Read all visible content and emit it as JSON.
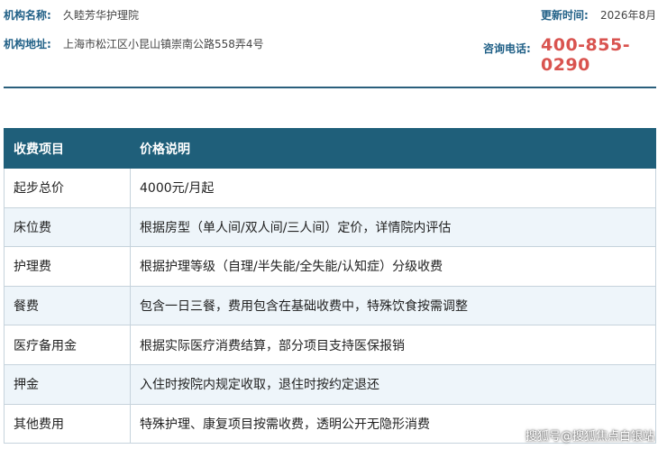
{
  "header": {
    "org_name_label": "机构名称:",
    "org_name": "久睦芳华护理院",
    "org_addr_label": "机构地址:",
    "org_addr": "上海市松江区小昆山镇崇南公路558弄4号",
    "updated_label": "更新时间:",
    "updated": "2026年8月",
    "phone_label": "咨询电话:",
    "phone": "400-855-0290"
  },
  "table": {
    "headers": [
      "收费项目",
      "价格说明"
    ],
    "rows": [
      [
        "起步总价",
        "4000元/月起"
      ],
      [
        "床位费",
        "根据房型（单人间/双人间/三人间）定价，详情院内评估"
      ],
      [
        "护理费",
        "根据护理等级（自理/半失能/全失能/认知症）分级收费"
      ],
      [
        "餐费",
        "包含一日三餐，费用包含在基础收费中，特殊饮食按需调整"
      ],
      [
        "医疗备用金",
        "根据实际医疗消费结算，部分项目支持医保报销"
      ],
      [
        "押金",
        "入住时按院内规定收取，退住时按约定退还"
      ],
      [
        "其他费用",
        "特殊护理、康复项目按需收费，透明公开无隐形消费"
      ]
    ]
  },
  "watermark": "搜狐号@搜狐焦点白银站"
}
